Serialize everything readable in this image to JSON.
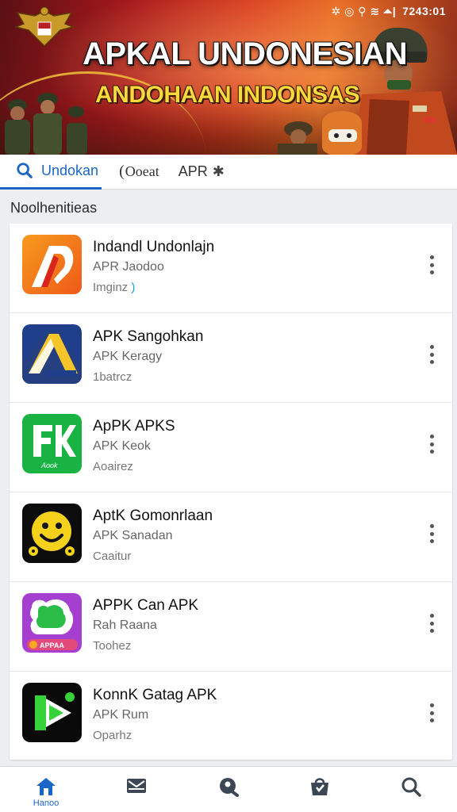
{
  "status_bar": {
    "time": "7243:01"
  },
  "hero": {
    "title": "APKAL UNDONESIAN",
    "subtitle": "ANDOHAAN INDONSAS"
  },
  "tabs": [
    {
      "label": "Undokan"
    },
    {
      "label": "Ooeat"
    },
    {
      "label": "APR"
    }
  ],
  "section_title": "Noolhenitieas",
  "apps": [
    {
      "name": "Indandl Undonlajn",
      "sub": "APR Jaodoo",
      "meta": "Imginz"
    },
    {
      "name": "APK Sangohkan",
      "sub": "APK Keragy",
      "meta": "1batrcz"
    },
    {
      "name": "ApPK APKS",
      "sub": "APK Keok",
      "meta": "Aoairez"
    },
    {
      "name": "AptK Gomonrlaan",
      "sub": "APK Sanadan",
      "meta": "Caaitur"
    },
    {
      "name": "APPK Can APK",
      "sub": "Rah Raana",
      "meta": "Toohez"
    },
    {
      "name": "KonnK Gatag APK",
      "sub": "APK Rum",
      "meta": "Oparhz"
    }
  ],
  "icon_texts": {
    "app3": "Aook",
    "app5": "APPAA"
  },
  "bottom_nav": [
    {
      "label": "Hanoo",
      "icon": "home-icon"
    },
    {
      "icon": "inbox-icon"
    },
    {
      "icon": "location-icon"
    },
    {
      "icon": "bag-icon"
    },
    {
      "icon": "search-icon"
    }
  ],
  "colors": {
    "accent": "#1a66c8"
  }
}
